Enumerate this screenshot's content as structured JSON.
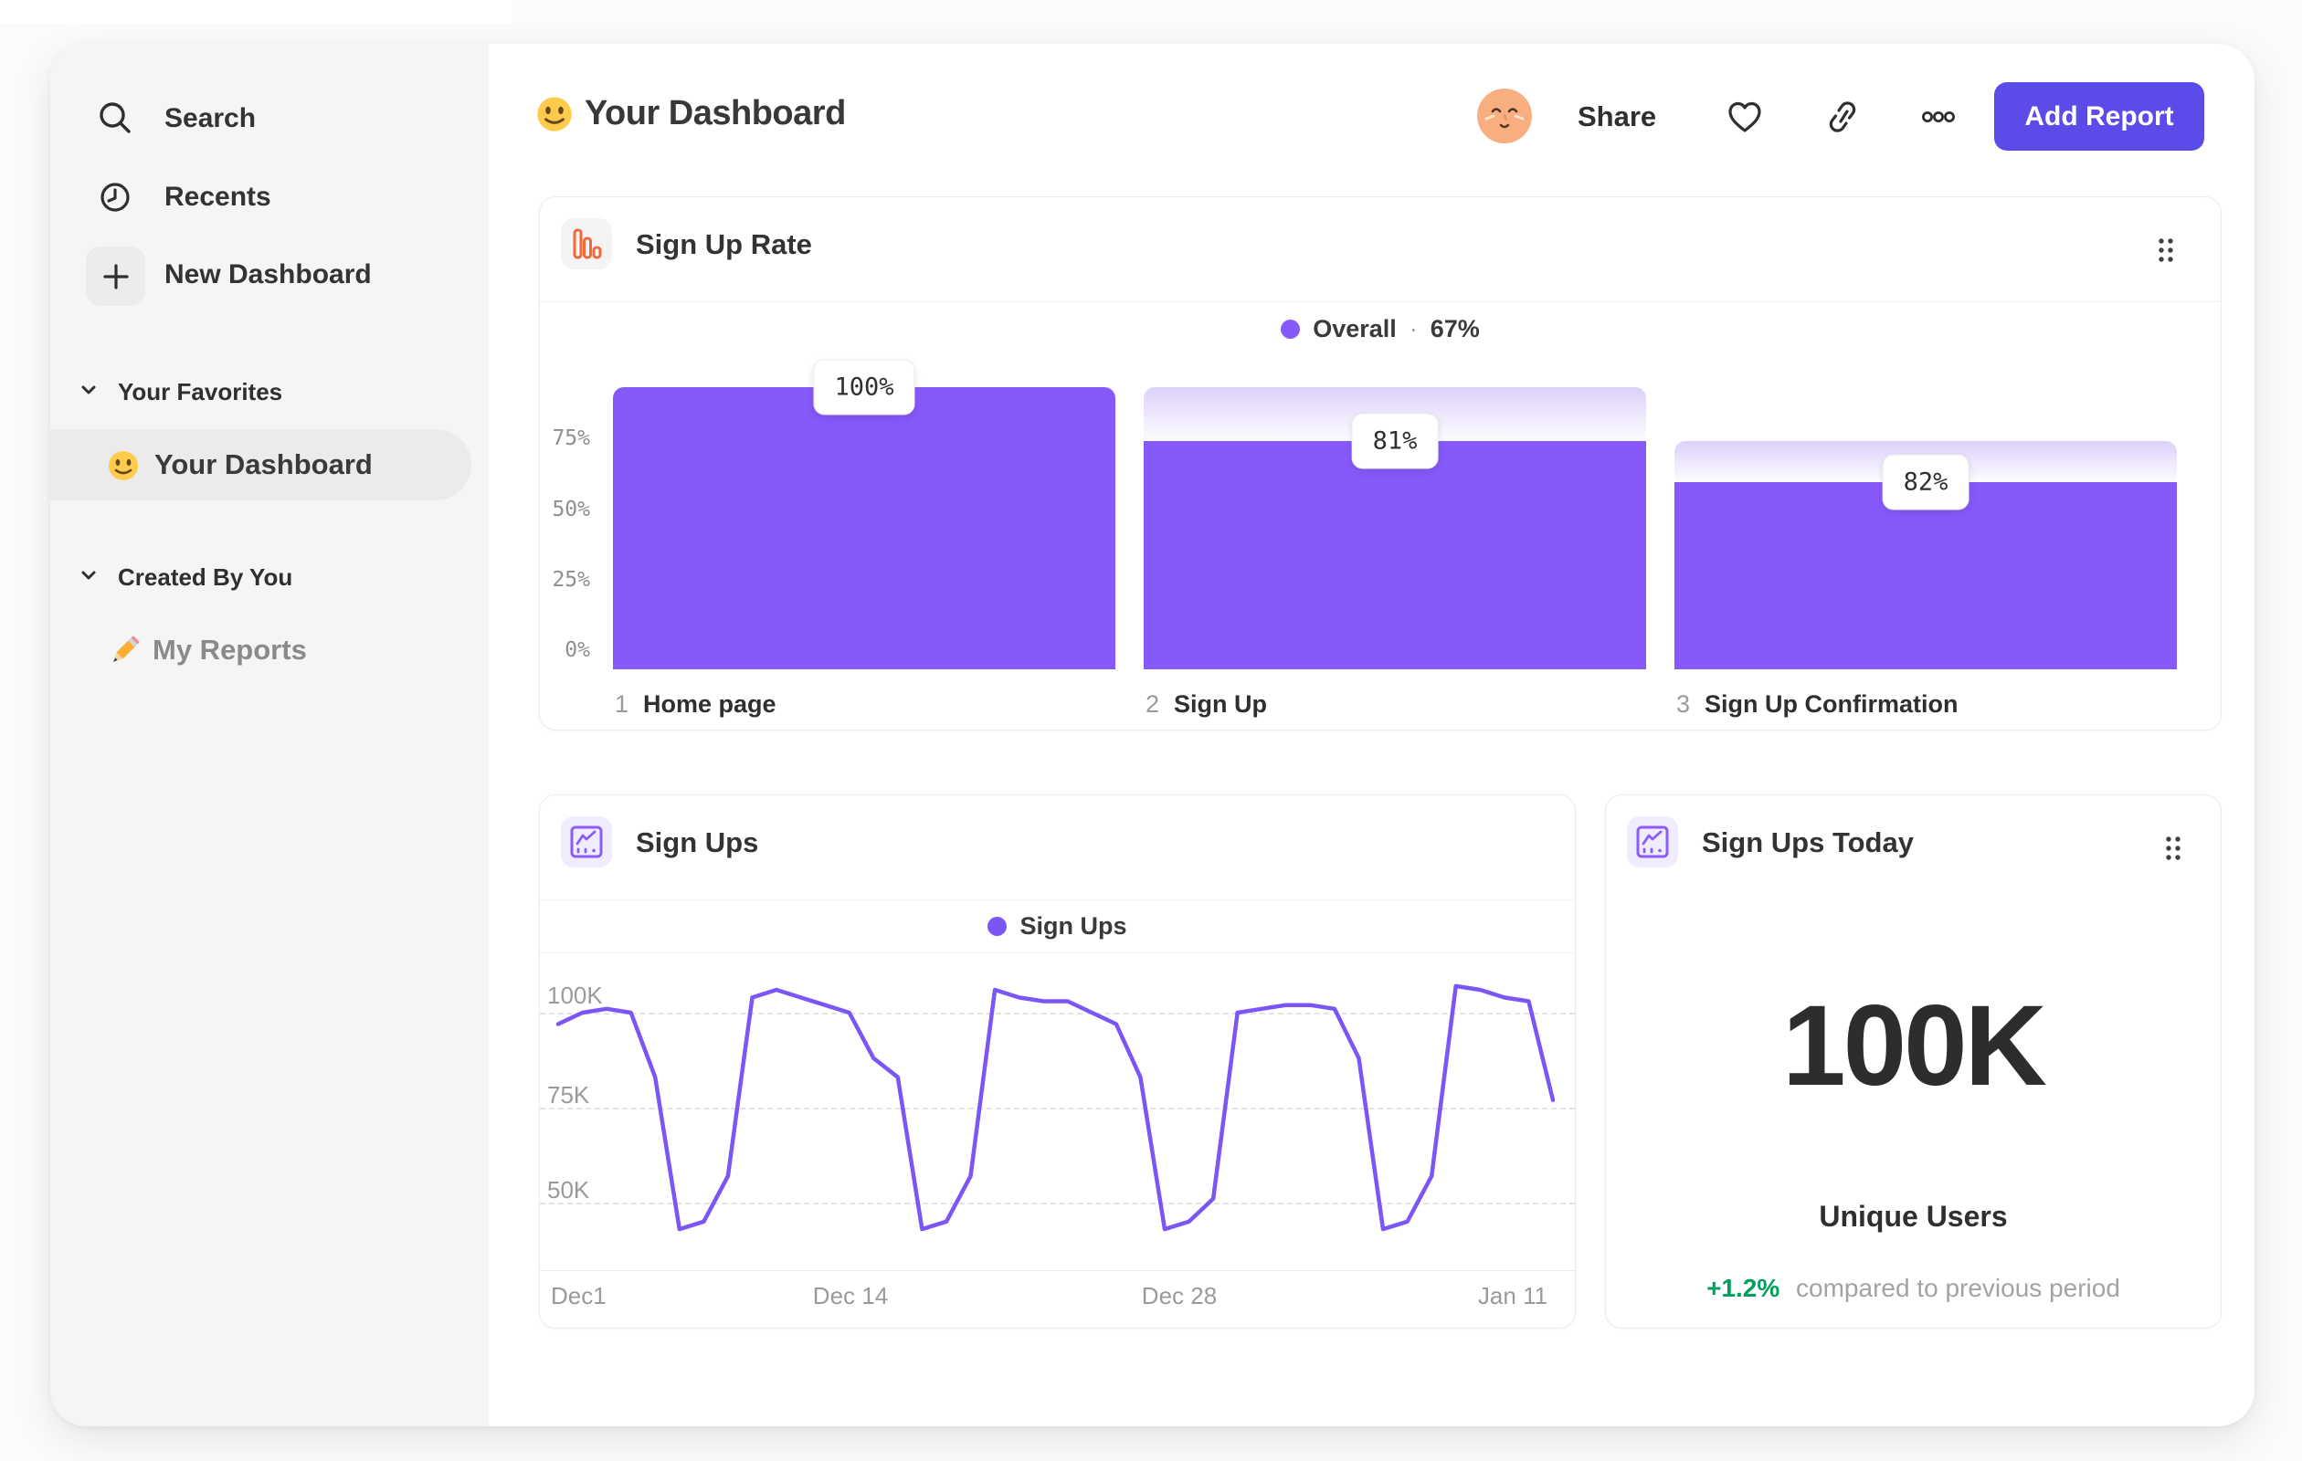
{
  "header": {
    "title_emoji_icon": "smiley-emoji",
    "title": "Your Dashboard",
    "avatar_icon": "user-avatar",
    "share_label": "Share",
    "action_icons": [
      "favorite-heart-icon",
      "copy-link-icon",
      "more-options-icon"
    ],
    "add_report_label": "Add Report",
    "accent_color": "#5B4BE9"
  },
  "sidebar": {
    "nav": [
      {
        "icon": "search-icon",
        "label": "Search"
      },
      {
        "icon": "recents-clock-icon",
        "label": "Recents"
      },
      {
        "icon": "plus-icon",
        "label": "New Dashboard"
      }
    ],
    "sections": [
      {
        "label": "Your Favorites",
        "items": [
          {
            "icon": "smiley-emoji",
            "label": "Your Dashboard",
            "selected": true
          }
        ]
      },
      {
        "label": "Created By You",
        "items": [
          {
            "icon": "pencil-emoji",
            "label": "My Reports",
            "selected": false
          }
        ]
      }
    ]
  },
  "cards": {
    "sign_up_rate": {
      "icon": "bar-chart-icon",
      "icon_color": "#F2683C",
      "title": "Sign Up Rate",
      "legend_label": "Overall",
      "legend_sep": "·",
      "legend_value": "67%"
    },
    "sign_ups": {
      "icon": "line-chart-icon",
      "icon_color": "#8B5CF6",
      "title": "Sign Ups",
      "legend_label": "Sign Ups"
    },
    "sign_ups_today": {
      "icon": "line-chart-icon",
      "icon_color": "#8B5CF6",
      "title": "Sign Ups Today",
      "value": "100K",
      "value_label": "Unique Users",
      "delta": "+1.2%",
      "delta_color": "#00A05C",
      "delta_note": "compared to previous period"
    }
  },
  "chart_data": [
    {
      "type": "bar",
      "subtype": "funnel",
      "title": "Sign Up Rate",
      "legend": [
        {
          "label": "Overall",
          "value": "67%",
          "color": "#8659FA"
        }
      ],
      "categories": [
        "Home page",
        "Sign Up",
        "Sign Up Confirmation"
      ],
      "step_numbers": [
        "1",
        "2",
        "3"
      ],
      "value_labels": [
        "100%",
        "81%",
        "82%"
      ],
      "values_pct_of_previous": [
        100,
        81,
        82
      ],
      "values_pct_overall": [
        100,
        81,
        66.5
      ],
      "y_ticks": [
        {
          "label": "75%",
          "value": 75
        },
        {
          "label": "50%",
          "value": 50
        },
        {
          "label": "25%",
          "value": 25
        },
        {
          "label": "0%",
          "value": 0
        }
      ],
      "ylim": [
        0,
        100
      ],
      "grid": false,
      "legend_position": "top-center",
      "bar_color": "#8659FA"
    },
    {
      "type": "line",
      "title": "Sign Ups",
      "legend": [
        {
          "label": "Sign Ups",
          "color": "#7C55F7"
        }
      ],
      "x_ticks": [
        "Dec1",
        "Dec 14",
        "Dec 28",
        "Jan 11"
      ],
      "y_ticks": [
        {
          "label": "100K",
          "value": 100
        },
        {
          "label": "75K",
          "value": 75
        },
        {
          "label": "50K",
          "value": 50
        }
      ],
      "x_range_days": 42,
      "values_k": [
        97,
        100,
        101,
        100,
        83,
        43,
        45,
        57,
        104,
        106,
        104,
        102,
        100,
        88,
        83,
        43,
        45,
        57,
        106,
        104,
        103,
        103,
        100,
        97,
        83,
        43,
        45,
        51,
        100,
        101,
        102,
        102,
        101,
        88,
        43,
        45,
        57,
        107,
        106,
        104,
        103,
        77
      ],
      "ylim": [
        40,
        110
      ],
      "grid": "dashed-horizontal",
      "legend_position": "top-center",
      "line_color": "#7C55F7"
    }
  ]
}
